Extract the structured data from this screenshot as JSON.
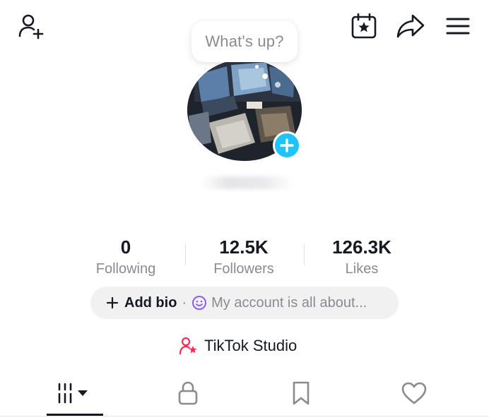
{
  "header": {
    "icons": [
      "add-friend-icon",
      "calendar-star-icon",
      "share-icon",
      "menu-icon"
    ]
  },
  "bubble": {
    "text": "What's up?"
  },
  "stats": [
    {
      "value": "0",
      "label": "Following"
    },
    {
      "value": "12.5K",
      "label": "Followers"
    },
    {
      "value": "126.3K",
      "label": "Likes"
    }
  ],
  "bio": {
    "add_label": "Add bio",
    "separator": "·",
    "placeholder": "My account is all about..."
  },
  "studio": {
    "label": "TikTok Studio"
  },
  "tabs": {
    "items": [
      "videos-grid-icon",
      "lock-icon",
      "bookmark-icon",
      "heart-icon"
    ],
    "active": 0
  },
  "colors": {
    "accent_blue": "#20c3f5",
    "studio_pink": "#fe2c55",
    "bio_emoji_purple": "#8b5cf6",
    "text_primary": "#161823",
    "text_secondary": "#8a8b91"
  }
}
